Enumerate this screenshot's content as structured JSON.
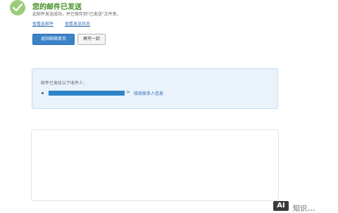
{
  "header": {
    "title": "您的邮件已发送",
    "subtitle": "此邮件发送成功，并已保存到\"已发送\"文件夹。",
    "links": [
      "查看此邮件",
      "查看发送状态"
    ]
  },
  "buttons": {
    "back_to_inbox": "返回邮箱首页",
    "write_another": "再写一封"
  },
  "recipients": {
    "title": "邮件已发给以下收件人：",
    "arrow": ">",
    "edit_label": "修改联系人信息"
  },
  "watermark": {
    "badge": "AI",
    "text": "知识..."
  },
  "colors": {
    "accent": "#3b83c9",
    "success": "#3e8e1f",
    "info_bg": "#eaf2fb"
  }
}
